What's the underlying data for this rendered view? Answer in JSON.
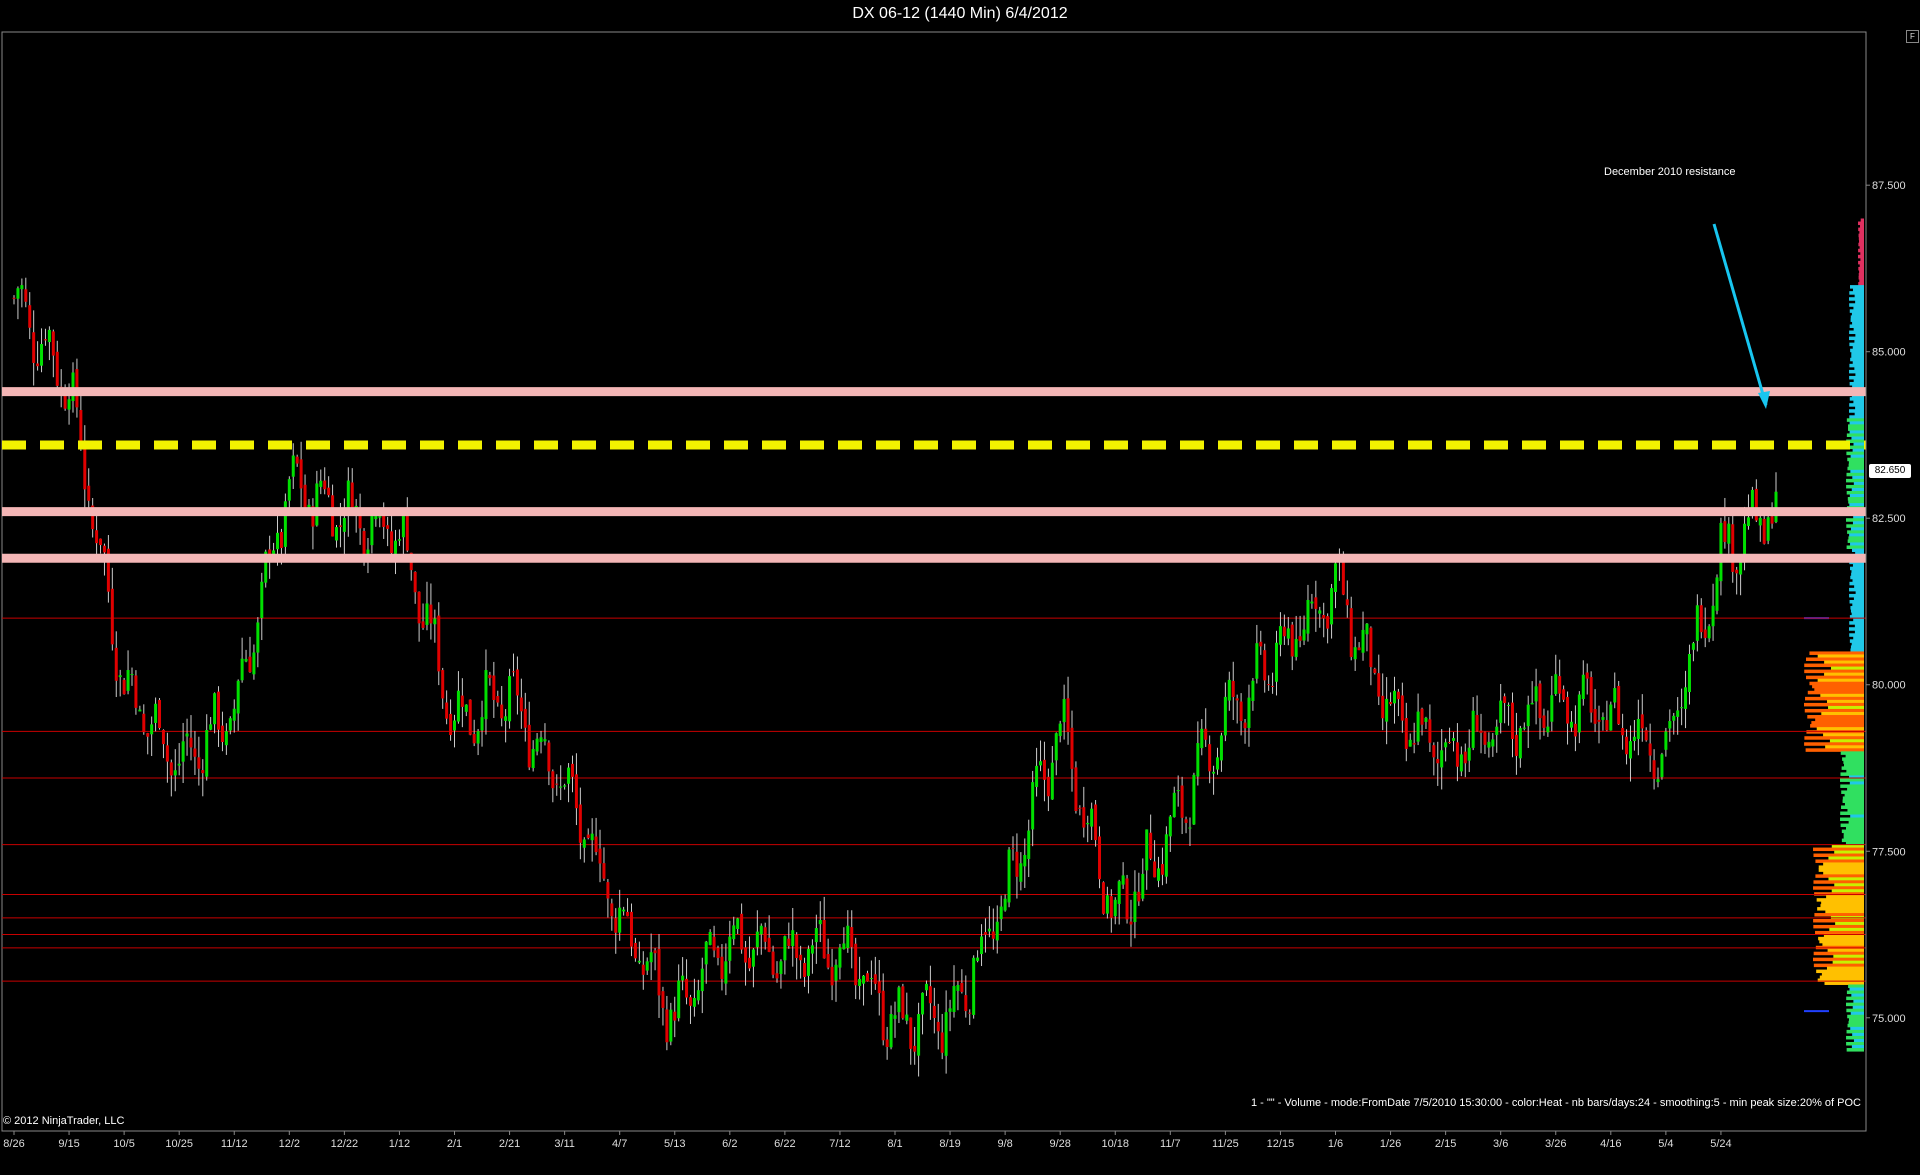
{
  "window": {
    "title": "DX 06-12 (1440 Min)  6/4/2012",
    "copyright": "© 2012 NinjaTrader, LLC",
    "indicator_label": "1 - \"\" - Volume - mode:FromDate 7/5/2010 15:30:00 - color:Heat - nb bars/days:24 - smoothing:5 - min peak size:20% of POC",
    "corner_button": "F"
  },
  "colors": {
    "background": "#000000",
    "up_candle": "#00e000",
    "down_candle": "#e00000",
    "wick": "#cccccc",
    "support_line": "#c80000",
    "resistance_band": "#f4b6b6",
    "dashed_resistance": "#f2f200",
    "arrow": "#18c6f0",
    "axis": "#888888"
  },
  "chart_data": {
    "type": "candlestick",
    "instrument": "DX 06-12",
    "timeframe": "1440 Min",
    "ylim": [
      73.3,
      89.8
    ],
    "yticks": [
      75.0,
      77.5,
      80.0,
      82.5,
      85.0,
      87.5
    ],
    "ytick_labels": [
      "75.000",
      "77.500",
      "80.000",
      "82.500",
      "85.000",
      "87.500"
    ],
    "xtick_labels": [
      "8/26",
      "9/15",
      "10/5",
      "10/25",
      "11/12",
      "12/2",
      "12/22",
      "1/12",
      "2/1",
      "2/21",
      "3/11",
      "4/7",
      "5/13",
      "6/2",
      "6/22",
      "7/12",
      "8/1",
      "8/19",
      "9/8",
      "9/28",
      "10/18",
      "11/7",
      "11/25",
      "12/15",
      "1/6",
      "1/26",
      "2/15",
      "3/6",
      "3/26",
      "4/16",
      "5/4",
      "5/24"
    ],
    "price_anchors": [
      {
        "label": "8/26",
        "close": 85.8
      },
      {
        "label": "9/15",
        "close": 84.5
      },
      {
        "label": "10/5",
        "close": 80.0
      },
      {
        "label": "10/25",
        "close": 78.8
      },
      {
        "label": "11/12",
        "close": 79.6
      },
      {
        "label": "12/2",
        "close": 83.0
      },
      {
        "label": "12/22",
        "close": 82.6
      },
      {
        "label": "1/12",
        "close": 82.3
      },
      {
        "label": "2/1",
        "close": 79.5
      },
      {
        "label": "2/21",
        "close": 79.8
      },
      {
        "label": "3/11",
        "close": 78.5
      },
      {
        "label": "4/7",
        "close": 76.5
      },
      {
        "label": "5/13",
        "close": 75.0
      },
      {
        "label": "6/2",
        "close": 76.2
      },
      {
        "label": "6/22",
        "close": 75.9
      },
      {
        "label": "7/12",
        "close": 76.1
      },
      {
        "label": "8/1",
        "close": 74.9
      },
      {
        "label": "8/19",
        "close": 75.0
      },
      {
        "label": "9/8",
        "close": 76.8
      },
      {
        "label": "9/28",
        "close": 79.4
      },
      {
        "label": "10/18",
        "close": 76.5
      },
      {
        "label": "11/7",
        "close": 77.8
      },
      {
        "label": "11/25",
        "close": 79.5
      },
      {
        "label": "12/15",
        "close": 80.5
      },
      {
        "label": "1/6",
        "close": 81.5
      },
      {
        "label": "1/26",
        "close": 79.5
      },
      {
        "label": "2/15",
        "close": 79.0
      },
      {
        "label": "3/6",
        "close": 79.3
      },
      {
        "label": "3/26",
        "close": 79.8
      },
      {
        "label": "4/16",
        "close": 79.5
      },
      {
        "label": "5/4",
        "close": 79.0
      },
      {
        "label": "5/24",
        "close": 82.0
      },
      {
        "label": "6/4",
        "close": 82.65
      }
    ],
    "last_price": "82.650",
    "horizontal_levels": {
      "resistance_bands": [
        84.4,
        82.6,
        81.9
      ],
      "dashed_resistance": 83.6,
      "support_lines": [
        81.0,
        79.3,
        78.6,
        77.6,
        76.85,
        76.5,
        76.25,
        76.05,
        75.55
      ]
    },
    "annotation": {
      "text": "December 2010 resistance",
      "arrow_to_price": 84.2
    },
    "volume_profile": {
      "orientation": "right",
      "poc_price": 80.0,
      "bands": [
        {
          "low": 86.0,
          "high": 87.0,
          "intensity": 0.1
        },
        {
          "low": 84.0,
          "high": 86.0,
          "intensity": 0.25
        },
        {
          "low": 82.0,
          "high": 84.0,
          "intensity": 0.3
        },
        {
          "low": 80.5,
          "high": 82.0,
          "intensity": 0.25
        },
        {
          "low": 79.0,
          "high": 80.5,
          "intensity": 1.0
        },
        {
          "low": 77.6,
          "high": 79.0,
          "intensity": 0.4
        },
        {
          "low": 75.5,
          "high": 77.6,
          "intensity": 0.85
        },
        {
          "low": 74.5,
          "high": 75.5,
          "intensity": 0.3
        }
      ]
    }
  }
}
